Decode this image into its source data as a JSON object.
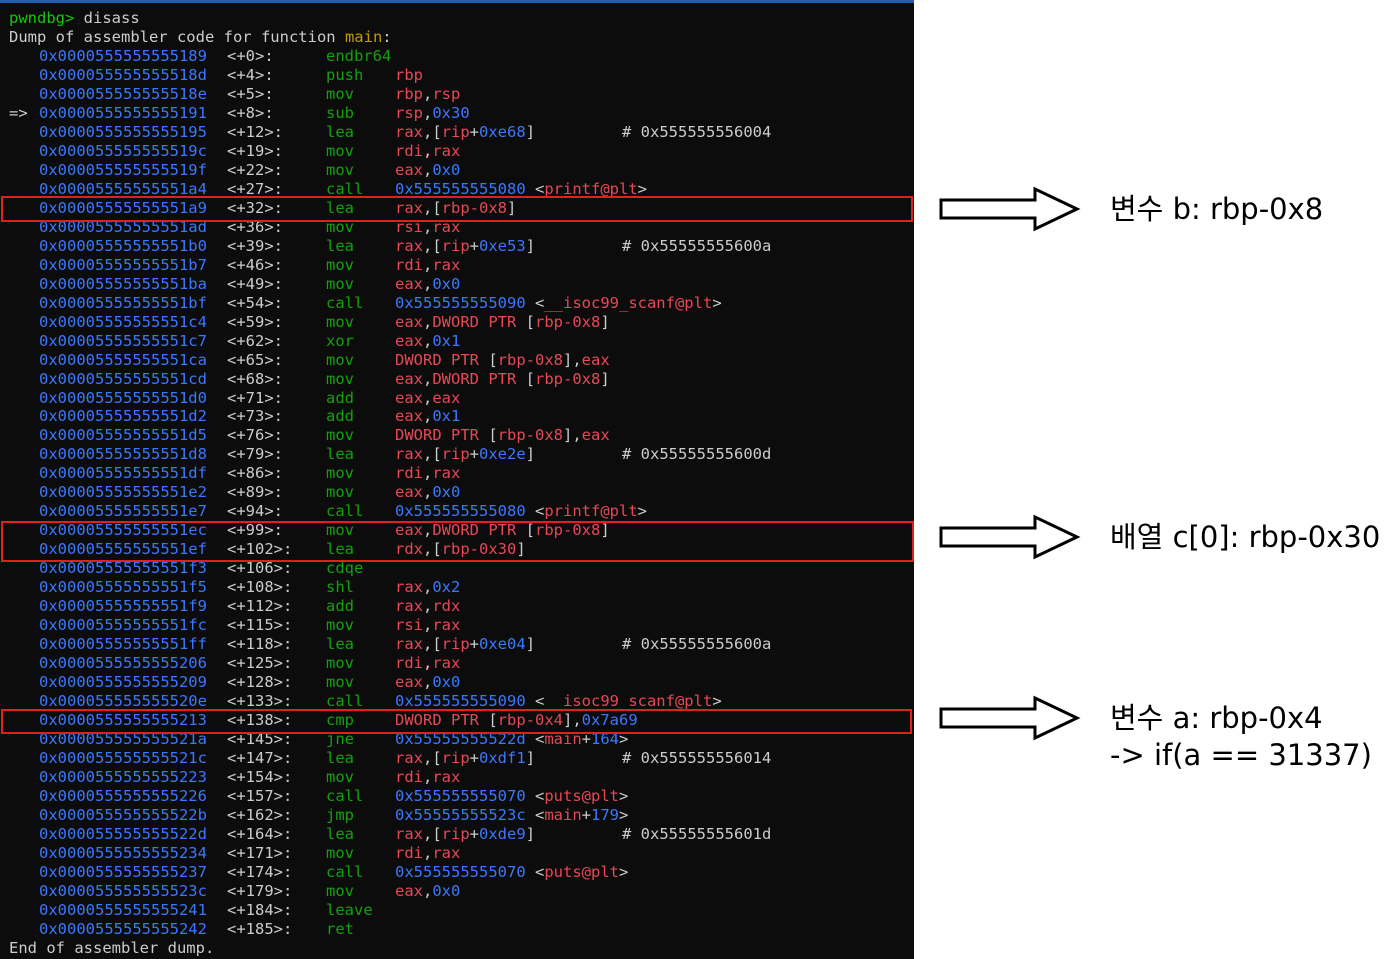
{
  "terminal": {
    "prompt": "pwndbg>",
    "command": "disass",
    "dump_header_prefix": "Dump of assembler code for function",
    "function_name": "main",
    "dump_footer": "End of assembler dump."
  },
  "colors": {
    "terminal_bg": "#0c0c0c",
    "address": "#3b78ff",
    "mnemonic": "#13a10e",
    "register": "#e74856",
    "text": "#cccccc",
    "highlight_border": "#e0201a"
  },
  "instructions": [
    {
      "arrow": "",
      "addr": "0x0000555555555189",
      "off": "<+0>:",
      "mn": "endbr64",
      "ops": []
    },
    {
      "arrow": "",
      "addr": "0x000055555555518d",
      "off": "<+4>:",
      "mn": "push",
      "ops": [
        {
          "t": "rbp",
          "k": "r"
        }
      ]
    },
    {
      "arrow": "",
      "addr": "0x000055555555518e",
      "off": "<+5>:",
      "mn": "mov",
      "ops": [
        {
          "t": "rbp",
          "k": "r"
        },
        {
          "t": ",",
          "k": "w"
        },
        {
          "t": "rsp",
          "k": "r"
        }
      ]
    },
    {
      "arrow": "=>",
      "addr": "0x0000555555555191",
      "off": "<+8>:",
      "mn": "sub",
      "ops": [
        {
          "t": "rsp",
          "k": "r"
        },
        {
          "t": ",",
          "k": "w"
        },
        {
          "t": "0x30",
          "k": "n"
        }
      ]
    },
    {
      "arrow": "",
      "addr": "0x0000555555555195",
      "off": "<+12>:",
      "mn": "lea",
      "ops": [
        {
          "t": "rax",
          "k": "r"
        },
        {
          "t": ",[",
          "k": "w"
        },
        {
          "t": "rip",
          "k": "r"
        },
        {
          "t": "+",
          "k": "w"
        },
        {
          "t": "0xe68",
          "k": "n"
        },
        {
          "t": "]",
          "k": "w"
        }
      ],
      "comment": "# 0x555555556004"
    },
    {
      "arrow": "",
      "addr": "0x000055555555519c",
      "off": "<+19>:",
      "mn": "mov",
      "ops": [
        {
          "t": "rdi",
          "k": "r"
        },
        {
          "t": ",",
          "k": "w"
        },
        {
          "t": "rax",
          "k": "r"
        }
      ]
    },
    {
      "arrow": "",
      "addr": "0x000055555555519f",
      "off": "<+22>:",
      "mn": "mov",
      "ops": [
        {
          "t": "eax",
          "k": "r"
        },
        {
          "t": ",",
          "k": "w"
        },
        {
          "t": "0x0",
          "k": "n"
        }
      ]
    },
    {
      "arrow": "",
      "addr": "0x00005555555551a4",
      "off": "<+27>:",
      "mn": "call",
      "ops": [
        {
          "t": "0x555555555080",
          "k": "n"
        },
        {
          "t": " <",
          "k": "w"
        },
        {
          "t": "printf@plt",
          "k": "r"
        },
        {
          "t": ">",
          "k": "w"
        }
      ]
    },
    {
      "arrow": "",
      "addr": "0x00005555555551a9",
      "off": "<+32>:",
      "mn": "lea",
      "ops": [
        {
          "t": "rax",
          "k": "r"
        },
        {
          "t": ",[",
          "k": "w"
        },
        {
          "t": "rbp-0x8",
          "k": "r"
        },
        {
          "t": "]",
          "k": "w"
        }
      ]
    },
    {
      "arrow": "",
      "addr": "0x00005555555551ad",
      "off": "<+36>:",
      "mn": "mov",
      "ops": [
        {
          "t": "rsi",
          "k": "r"
        },
        {
          "t": ",",
          "k": "w"
        },
        {
          "t": "rax",
          "k": "r"
        }
      ]
    },
    {
      "arrow": "",
      "addr": "0x00005555555551b0",
      "off": "<+39>:",
      "mn": "lea",
      "ops": [
        {
          "t": "rax",
          "k": "r"
        },
        {
          "t": ",[",
          "k": "w"
        },
        {
          "t": "rip",
          "k": "r"
        },
        {
          "t": "+",
          "k": "w"
        },
        {
          "t": "0xe53",
          "k": "n"
        },
        {
          "t": "]",
          "k": "w"
        }
      ],
      "comment": "# 0x55555555600a"
    },
    {
      "arrow": "",
      "addr": "0x00005555555551b7",
      "off": "<+46>:",
      "mn": "mov",
      "ops": [
        {
          "t": "rdi",
          "k": "r"
        },
        {
          "t": ",",
          "k": "w"
        },
        {
          "t": "rax",
          "k": "r"
        }
      ]
    },
    {
      "arrow": "",
      "addr": "0x00005555555551ba",
      "off": "<+49>:",
      "mn": "mov",
      "ops": [
        {
          "t": "eax",
          "k": "r"
        },
        {
          "t": ",",
          "k": "w"
        },
        {
          "t": "0x0",
          "k": "n"
        }
      ]
    },
    {
      "arrow": "",
      "addr": "0x00005555555551bf",
      "off": "<+54>:",
      "mn": "call",
      "ops": [
        {
          "t": "0x555555555090",
          "k": "n"
        },
        {
          "t": " <",
          "k": "w"
        },
        {
          "t": "__isoc99_scanf@plt",
          "k": "r"
        },
        {
          "t": ">",
          "k": "w"
        }
      ]
    },
    {
      "arrow": "",
      "addr": "0x00005555555551c4",
      "off": "<+59>:",
      "mn": "mov",
      "ops": [
        {
          "t": "eax",
          "k": "r"
        },
        {
          "t": ",",
          "k": "w"
        },
        {
          "t": "DWORD PTR ",
          "k": "r"
        },
        {
          "t": "[",
          "k": "w"
        },
        {
          "t": "rbp-0x8",
          "k": "r"
        },
        {
          "t": "]",
          "k": "w"
        }
      ]
    },
    {
      "arrow": "",
      "addr": "0x00005555555551c7",
      "off": "<+62>:",
      "mn": "xor",
      "ops": [
        {
          "t": "eax",
          "k": "r"
        },
        {
          "t": ",",
          "k": "w"
        },
        {
          "t": "0x1",
          "k": "n"
        }
      ]
    },
    {
      "arrow": "",
      "addr": "0x00005555555551ca",
      "off": "<+65>:",
      "mn": "mov",
      "ops": [
        {
          "t": "DWORD PTR ",
          "k": "r"
        },
        {
          "t": "[",
          "k": "w"
        },
        {
          "t": "rbp-0x8",
          "k": "r"
        },
        {
          "t": "],",
          "k": "w"
        },
        {
          "t": "eax",
          "k": "r"
        }
      ]
    },
    {
      "arrow": "",
      "addr": "0x00005555555551cd",
      "off": "<+68>:",
      "mn": "mov",
      "ops": [
        {
          "t": "eax",
          "k": "r"
        },
        {
          "t": ",",
          "k": "w"
        },
        {
          "t": "DWORD PTR ",
          "k": "r"
        },
        {
          "t": "[",
          "k": "w"
        },
        {
          "t": "rbp-0x8",
          "k": "r"
        },
        {
          "t": "]",
          "k": "w"
        }
      ]
    },
    {
      "arrow": "",
      "addr": "0x00005555555551d0",
      "off": "<+71>:",
      "mn": "add",
      "ops": [
        {
          "t": "eax",
          "k": "r"
        },
        {
          "t": ",",
          "k": "w"
        },
        {
          "t": "eax",
          "k": "r"
        }
      ]
    },
    {
      "arrow": "",
      "addr": "0x00005555555551d2",
      "off": "<+73>:",
      "mn": "add",
      "ops": [
        {
          "t": "eax",
          "k": "r"
        },
        {
          "t": ",",
          "k": "w"
        },
        {
          "t": "0x1",
          "k": "n"
        }
      ]
    },
    {
      "arrow": "",
      "addr": "0x00005555555551d5",
      "off": "<+76>:",
      "mn": "mov",
      "ops": [
        {
          "t": "DWORD PTR ",
          "k": "r"
        },
        {
          "t": "[",
          "k": "w"
        },
        {
          "t": "rbp-0x8",
          "k": "r"
        },
        {
          "t": "],",
          "k": "w"
        },
        {
          "t": "eax",
          "k": "r"
        }
      ]
    },
    {
      "arrow": "",
      "addr": "0x00005555555551d8",
      "off": "<+79>:",
      "mn": "lea",
      "ops": [
        {
          "t": "rax",
          "k": "r"
        },
        {
          "t": ",[",
          "k": "w"
        },
        {
          "t": "rip",
          "k": "r"
        },
        {
          "t": "+",
          "k": "w"
        },
        {
          "t": "0xe2e",
          "k": "n"
        },
        {
          "t": "]",
          "k": "w"
        }
      ],
      "comment": "# 0x55555555600d"
    },
    {
      "arrow": "",
      "addr": "0x00005555555551df",
      "off": "<+86>:",
      "mn": "mov",
      "ops": [
        {
          "t": "rdi",
          "k": "r"
        },
        {
          "t": ",",
          "k": "w"
        },
        {
          "t": "rax",
          "k": "r"
        }
      ]
    },
    {
      "arrow": "",
      "addr": "0x00005555555551e2",
      "off": "<+89>:",
      "mn": "mov",
      "ops": [
        {
          "t": "eax",
          "k": "r"
        },
        {
          "t": ",",
          "k": "w"
        },
        {
          "t": "0x0",
          "k": "n"
        }
      ]
    },
    {
      "arrow": "",
      "addr": "0x00005555555551e7",
      "off": "<+94>:",
      "mn": "call",
      "ops": [
        {
          "t": "0x555555555080",
          "k": "n"
        },
        {
          "t": " <",
          "k": "w"
        },
        {
          "t": "printf@plt",
          "k": "r"
        },
        {
          "t": ">",
          "k": "w"
        }
      ]
    },
    {
      "arrow": "",
      "addr": "0x00005555555551ec",
      "off": "<+99>:",
      "mn": "mov",
      "ops": [
        {
          "t": "eax",
          "k": "r"
        },
        {
          "t": ",",
          "k": "w"
        },
        {
          "t": "DWORD PTR ",
          "k": "r"
        },
        {
          "t": "[",
          "k": "w"
        },
        {
          "t": "rbp-0x8",
          "k": "r"
        },
        {
          "t": "]",
          "k": "w"
        }
      ]
    },
    {
      "arrow": "",
      "addr": "0x00005555555551ef",
      "off": "<+102>:",
      "mn": "lea",
      "ops": [
        {
          "t": "rdx",
          "k": "r"
        },
        {
          "t": ",[",
          "k": "w"
        },
        {
          "t": "rbp-0x30",
          "k": "r"
        },
        {
          "t": "]",
          "k": "w"
        }
      ]
    },
    {
      "arrow": "",
      "addr": "0x00005555555551f3",
      "off": "<+106>:",
      "mn": "cdqe",
      "ops": []
    },
    {
      "arrow": "",
      "addr": "0x00005555555551f5",
      "off": "<+108>:",
      "mn": "shl",
      "ops": [
        {
          "t": "rax",
          "k": "r"
        },
        {
          "t": ",",
          "k": "w"
        },
        {
          "t": "0x2",
          "k": "n"
        }
      ]
    },
    {
      "arrow": "",
      "addr": "0x00005555555551f9",
      "off": "<+112>:",
      "mn": "add",
      "ops": [
        {
          "t": "rax",
          "k": "r"
        },
        {
          "t": ",",
          "k": "w"
        },
        {
          "t": "rdx",
          "k": "r"
        }
      ]
    },
    {
      "arrow": "",
      "addr": "0x00005555555551fc",
      "off": "<+115>:",
      "mn": "mov",
      "ops": [
        {
          "t": "rsi",
          "k": "r"
        },
        {
          "t": ",",
          "k": "w"
        },
        {
          "t": "rax",
          "k": "r"
        }
      ]
    },
    {
      "arrow": "",
      "addr": "0x00005555555551ff",
      "off": "<+118>:",
      "mn": "lea",
      "ops": [
        {
          "t": "rax",
          "k": "r"
        },
        {
          "t": ",[",
          "k": "w"
        },
        {
          "t": "rip",
          "k": "r"
        },
        {
          "t": "+",
          "k": "w"
        },
        {
          "t": "0xe04",
          "k": "n"
        },
        {
          "t": "]",
          "k": "w"
        }
      ],
      "comment": "# 0x55555555600a"
    },
    {
      "arrow": "",
      "addr": "0x0000555555555206",
      "off": "<+125>:",
      "mn": "mov",
      "ops": [
        {
          "t": "rdi",
          "k": "r"
        },
        {
          "t": ",",
          "k": "w"
        },
        {
          "t": "rax",
          "k": "r"
        }
      ]
    },
    {
      "arrow": "",
      "addr": "0x0000555555555209",
      "off": "<+128>:",
      "mn": "mov",
      "ops": [
        {
          "t": "eax",
          "k": "r"
        },
        {
          "t": ",",
          "k": "w"
        },
        {
          "t": "0x0",
          "k": "n"
        }
      ]
    },
    {
      "arrow": "",
      "addr": "0x000055555555520e",
      "off": "<+133>:",
      "mn": "call",
      "ops": [
        {
          "t": "0x555555555090",
          "k": "n"
        },
        {
          "t": " <",
          "k": "w"
        },
        {
          "t": "__isoc99_scanf@plt",
          "k": "r"
        },
        {
          "t": ">",
          "k": "w"
        }
      ]
    },
    {
      "arrow": "",
      "addr": "0x0000555555555213",
      "off": "<+138>:",
      "mn": "cmp",
      "ops": [
        {
          "t": "DWORD PTR ",
          "k": "r"
        },
        {
          "t": "[",
          "k": "w"
        },
        {
          "t": "rbp-0x4",
          "k": "r"
        },
        {
          "t": "],",
          "k": "w"
        },
        {
          "t": "0x7a69",
          "k": "n"
        }
      ]
    },
    {
      "arrow": "",
      "addr": "0x000055555555521a",
      "off": "<+145>:",
      "mn": "jne",
      "ops": [
        {
          "t": "0x55555555522d",
          "k": "n"
        },
        {
          "t": " <",
          "k": "w"
        },
        {
          "t": "main",
          "k": "r"
        },
        {
          "t": "+",
          "k": "w"
        },
        {
          "t": "164",
          "k": "n"
        },
        {
          "t": ">",
          "k": "w"
        }
      ]
    },
    {
      "arrow": "",
      "addr": "0x000055555555521c",
      "off": "<+147>:",
      "mn": "lea",
      "ops": [
        {
          "t": "rax",
          "k": "r"
        },
        {
          "t": ",[",
          "k": "w"
        },
        {
          "t": "rip",
          "k": "r"
        },
        {
          "t": "+",
          "k": "w"
        },
        {
          "t": "0xdf1",
          "k": "n"
        },
        {
          "t": "]",
          "k": "w"
        }
      ],
      "comment": "# 0x555555556014"
    },
    {
      "arrow": "",
      "addr": "0x0000555555555223",
      "off": "<+154>:",
      "mn": "mov",
      "ops": [
        {
          "t": "rdi",
          "k": "r"
        },
        {
          "t": ",",
          "k": "w"
        },
        {
          "t": "rax",
          "k": "r"
        }
      ]
    },
    {
      "arrow": "",
      "addr": "0x0000555555555226",
      "off": "<+157>:",
      "mn": "call",
      "ops": [
        {
          "t": "0x555555555070",
          "k": "n"
        },
        {
          "t": " <",
          "k": "w"
        },
        {
          "t": "puts@plt",
          "k": "r"
        },
        {
          "t": ">",
          "k": "w"
        }
      ]
    },
    {
      "arrow": "",
      "addr": "0x000055555555522b",
      "off": "<+162>:",
      "mn": "jmp",
      "ops": [
        {
          "t": "0x55555555523c",
          "k": "n"
        },
        {
          "t": " <",
          "k": "w"
        },
        {
          "t": "main",
          "k": "r"
        },
        {
          "t": "+",
          "k": "w"
        },
        {
          "t": "179",
          "k": "n"
        },
        {
          "t": ">",
          "k": "w"
        }
      ]
    },
    {
      "arrow": "",
      "addr": "0x000055555555522d",
      "off": "<+164>:",
      "mn": "lea",
      "ops": [
        {
          "t": "rax",
          "k": "r"
        },
        {
          "t": ",[",
          "k": "w"
        },
        {
          "t": "rip",
          "k": "r"
        },
        {
          "t": "+",
          "k": "w"
        },
        {
          "t": "0xde9",
          "k": "n"
        },
        {
          "t": "]",
          "k": "w"
        }
      ],
      "comment": "# 0x55555555601d"
    },
    {
      "arrow": "",
      "addr": "0x0000555555555234",
      "off": "<+171>:",
      "mn": "mov",
      "ops": [
        {
          "t": "rdi",
          "k": "r"
        },
        {
          "t": ",",
          "k": "w"
        },
        {
          "t": "rax",
          "k": "r"
        }
      ]
    },
    {
      "arrow": "",
      "addr": "0x0000555555555237",
      "off": "<+174>:",
      "mn": "call",
      "ops": [
        {
          "t": "0x555555555070",
          "k": "n"
        },
        {
          "t": " <",
          "k": "w"
        },
        {
          "t": "puts@plt",
          "k": "r"
        },
        {
          "t": ">",
          "k": "w"
        }
      ]
    },
    {
      "arrow": "",
      "addr": "0x000055555555523c",
      "off": "<+179>:",
      "mn": "mov",
      "ops": [
        {
          "t": "eax",
          "k": "r"
        },
        {
          "t": ",",
          "k": "w"
        },
        {
          "t": "0x0",
          "k": "n"
        }
      ]
    },
    {
      "arrow": "",
      "addr": "0x0000555555555241",
      "off": "<+184>:",
      "mn": "leave",
      "ops": []
    },
    {
      "arrow": "",
      "addr": "0x0000555555555242",
      "off": "<+185>:",
      "mn": "ret",
      "ops": []
    }
  ],
  "annotations": [
    {
      "label": "변수 b: rbp-0x8",
      "arrow_icon": "hollow-right-arrow-icon"
    },
    {
      "label": "배열 c[0]: rbp-0x30",
      "arrow_icon": "hollow-right-arrow-icon"
    },
    {
      "label": "변수 a: rbp-0x4",
      "line2": "-> if(a == 31337)",
      "arrow_icon": "hollow-right-arrow-icon"
    }
  ]
}
